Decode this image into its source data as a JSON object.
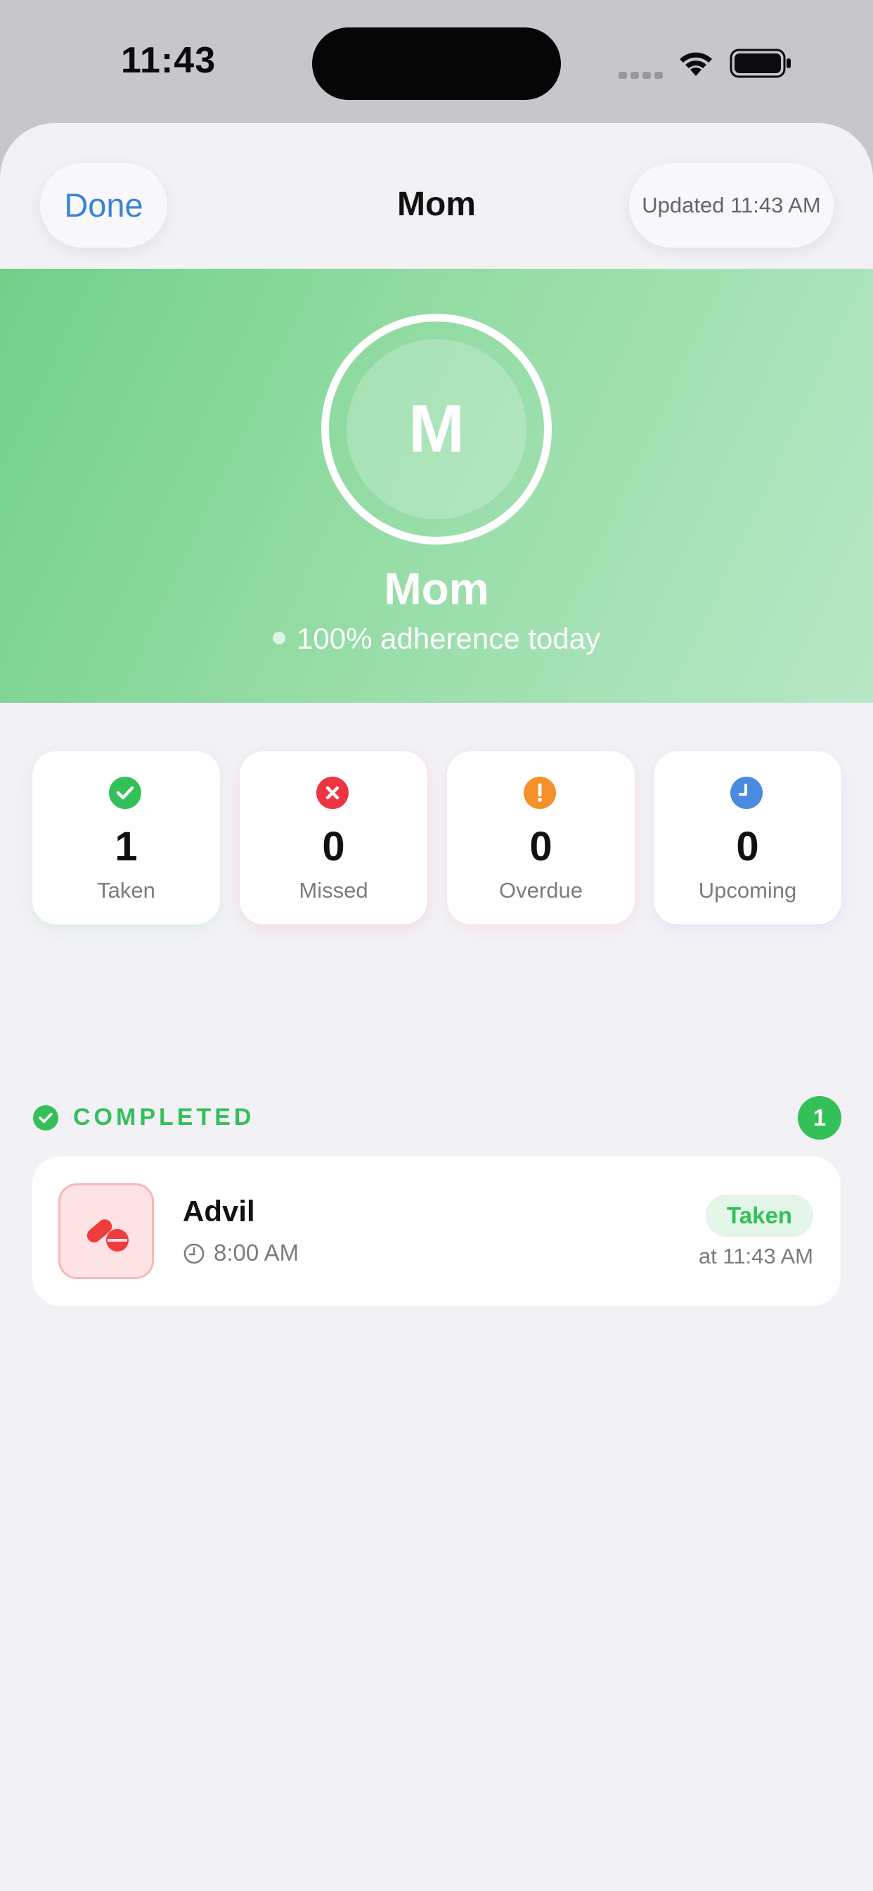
{
  "status_bar": {
    "time": "11:43"
  },
  "nav": {
    "done_label": "Done",
    "title": "Mom",
    "updated_label": "Updated 11:43 AM"
  },
  "profile": {
    "initial": "M",
    "name": "Mom",
    "adherence": "100% adherence today",
    "gradient_colors": [
      "#72d08a",
      "#b7e7c5"
    ]
  },
  "stats": [
    {
      "value": "1",
      "label": "Taken",
      "icon": "check-circle-icon",
      "color": "#34c059"
    },
    {
      "value": "0",
      "label": "Missed",
      "icon": "x-circle-icon",
      "color": "#ef3340"
    },
    {
      "value": "0",
      "label": "Overdue",
      "icon": "exclamation-circle-icon",
      "color": "#f5902a"
    },
    {
      "value": "0",
      "label": "Upcoming",
      "icon": "clock-circle-icon",
      "color": "#4a8be0"
    }
  ],
  "section": {
    "title": "COMPLETED",
    "count": "1",
    "color": "#34c059"
  },
  "medications": [
    {
      "name": "Advil",
      "scheduled_time": "8:00 AM",
      "status": "Taken",
      "taken_at": "at 11:43 AM",
      "icon": "pills-icon",
      "icon_color": "#ef3d3d"
    }
  ]
}
